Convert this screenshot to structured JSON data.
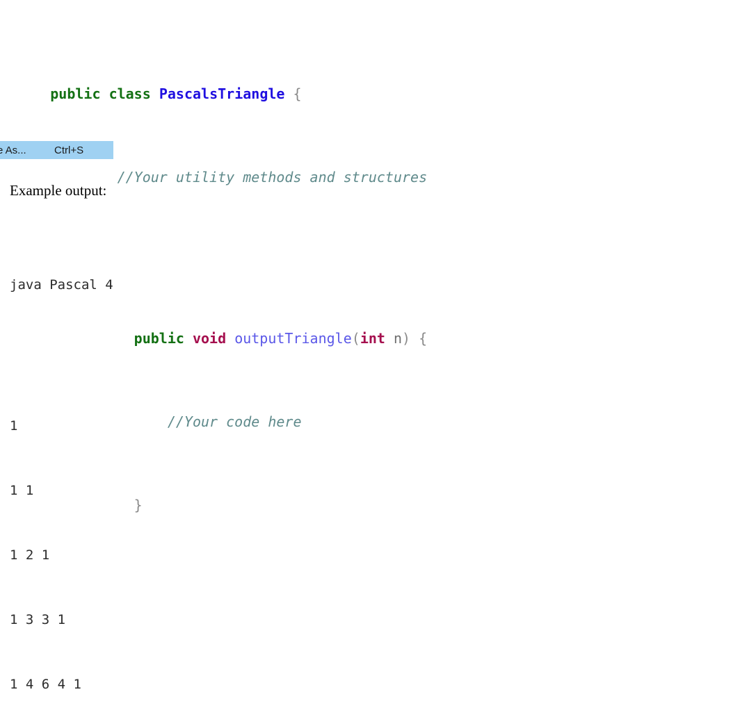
{
  "document": {
    "background_color": "#ffffff"
  },
  "code_snippet": {
    "language": "java",
    "colors": {
      "keyword": "#137013",
      "type": "#a50f4e",
      "class_name": "#1f0fe0",
      "method_name": "#5b58e8",
      "punctuation": "#8a8a8a",
      "identifier": "#6e6e6e",
      "comment": "#5f8a8b"
    },
    "lines": {
      "l1_public": "public",
      "l1_class_kw": "class",
      "l1_class_name": "PascalsTriangle",
      "l1_brace": "{",
      "l2_comment": "//Your utility methods and structures",
      "l4_public": "public",
      "l4_void": "void",
      "l4_method": "outputTriangle",
      "l4_paren_open": "(",
      "l4_int": "int",
      "l4_param": "n",
      "l4_paren_close": ")",
      "l4_brace": "{",
      "l5_comment": "//Your code here",
      "l6_brace": "}"
    }
  },
  "menu_fragment": {
    "label": "e As...",
    "shortcut": "Ctrl+S",
    "highlight_color": "#9fd1f2"
  },
  "prose": {
    "example_output_heading": "Example output:"
  },
  "console_output": {
    "command": "java Pascal 4",
    "triangle_rows": [
      "1",
      "1 1",
      "1 2 1",
      "1 3 3 1",
      "1 4 6 4 1"
    ]
  }
}
